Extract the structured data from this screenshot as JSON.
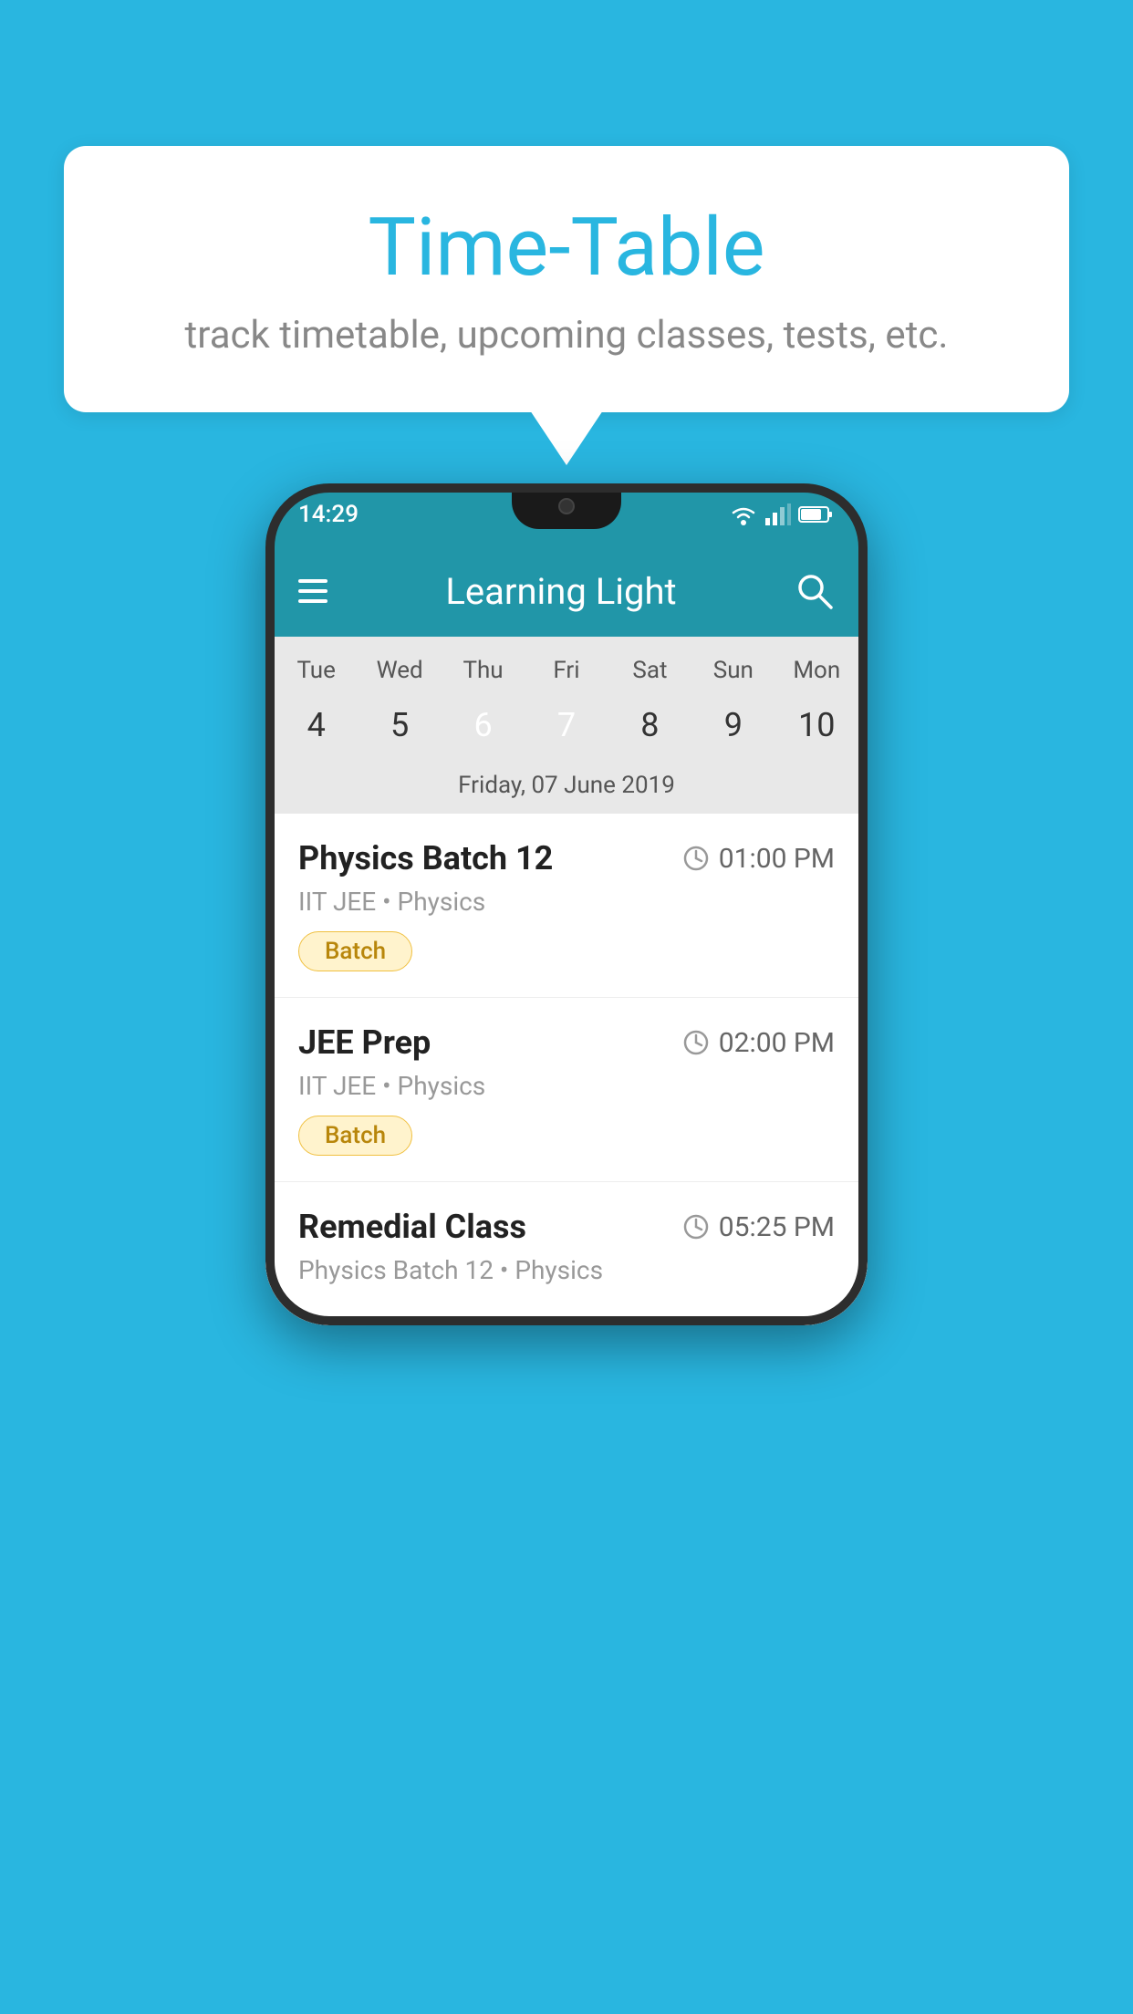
{
  "background_color": "#29b6e0",
  "speech_bubble": {
    "title": "Time-Table",
    "subtitle": "track timetable, upcoming classes, tests, etc."
  },
  "phone": {
    "status_bar": {
      "time": "14:29"
    },
    "app_header": {
      "title": "Learning Light"
    },
    "calendar": {
      "days": [
        "Tue",
        "Wed",
        "Thu",
        "Fri",
        "Sat",
        "Sun",
        "Mon"
      ],
      "dates": [
        "4",
        "5",
        "6",
        "7",
        "8",
        "9",
        "10"
      ],
      "today_index": 2,
      "selected_index": 3,
      "selected_label": "Friday, 07 June 2019"
    },
    "schedule": [
      {
        "title": "Physics Batch 12",
        "time": "01:00 PM",
        "subtitle": "IIT JEE • Physics",
        "tag": "Batch"
      },
      {
        "title": "JEE Prep",
        "time": "02:00 PM",
        "subtitle": "IIT JEE • Physics",
        "tag": "Batch"
      },
      {
        "title": "Remedial Class",
        "time": "05:25 PM",
        "subtitle": "Physics Batch 12 • Physics",
        "tag": null
      }
    ]
  }
}
